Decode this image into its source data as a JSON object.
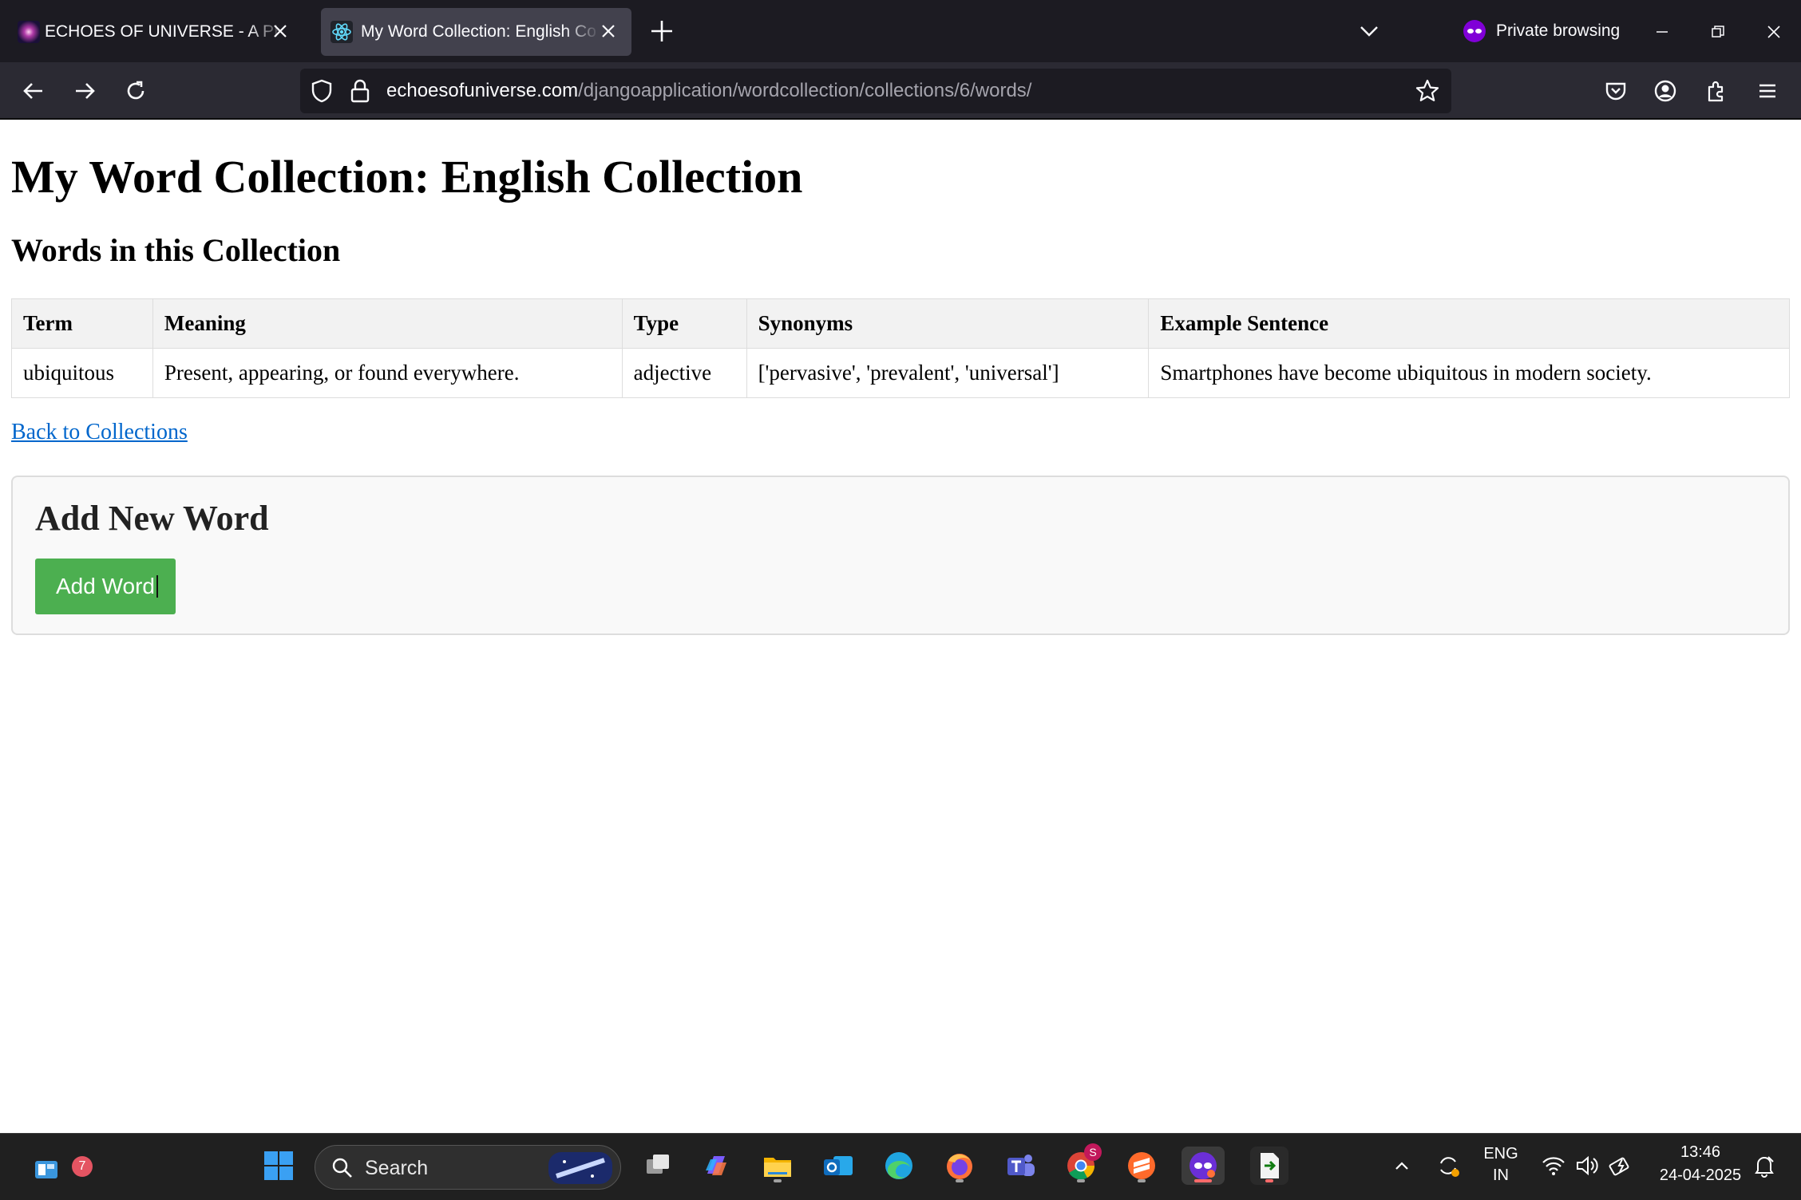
{
  "browser": {
    "tabs": [
      {
        "title": "ECHOES OF UNIVERSE - A PHRO"
      },
      {
        "title": "My Word Collection: English Co"
      }
    ],
    "private_label": "Private browsing",
    "url": {
      "host": "echoesofuniverse.com",
      "path": "/djangoapplication/wordcollection/collections/6/words/"
    }
  },
  "page": {
    "title": "My Word Collection: English Collection",
    "subtitle": "Words in this Collection",
    "table": {
      "headers": [
        "Term",
        "Meaning",
        "Type",
        "Synonyms",
        "Example Sentence"
      ],
      "rows": [
        [
          "ubiquitous",
          "Present, appearing, or found everywhere.",
          "adjective",
          "['pervasive', 'prevalent', 'universal']",
          "Smartphones have become ubiquitous in modern society."
        ]
      ]
    },
    "back_link": "Back to Collections",
    "add_section": {
      "heading": "Add New Word",
      "button": "Add Word"
    },
    "colors": {
      "button": "#4caf50",
      "link": "#0066cc"
    }
  },
  "taskbar": {
    "widget_badge": "7",
    "search_label": "Search",
    "chrome_badge": "S",
    "lang_1": "ENG",
    "lang_2": "IN",
    "time": "13:46",
    "date": "24-04-2025"
  }
}
